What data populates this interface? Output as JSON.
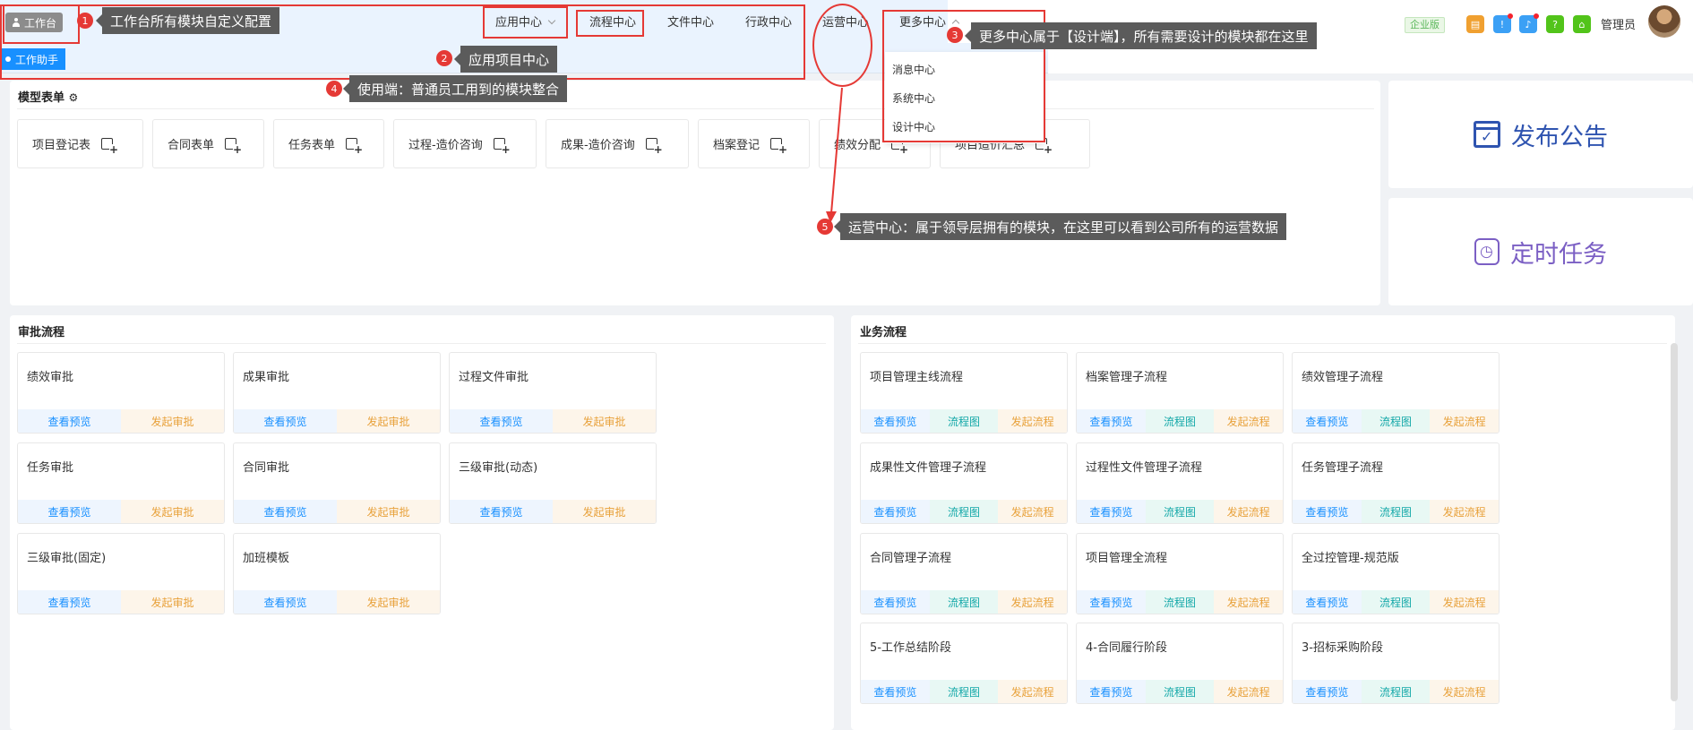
{
  "header": {
    "workbench_tag": "工作台",
    "nav": {
      "app_center": "应用中心",
      "process_center": "流程中心",
      "file_center": "文件中心",
      "admin_center": "行政中心",
      "ops_center": "运营中心",
      "more_center": "更多中心"
    },
    "edition_badge": "企业版",
    "admin_label": "管理员",
    "icon_colors": [
      "#f0a030",
      "#3ba0f5",
      "#3ba0f5",
      "#52c41a",
      "#52c41a"
    ]
  },
  "subbar": {
    "assistant_tab": "工作助手"
  },
  "dropdown": {
    "items": [
      "消息中心",
      "系统中心",
      "设计中心"
    ]
  },
  "model_forms": {
    "title": "模型表单",
    "items": [
      "项目登记表",
      "合同表单",
      "任务表单",
      "过程-造价咨询",
      "成果-造价咨询",
      "档案登记",
      "绩效分配",
      "项目造价汇总"
    ]
  },
  "side_cards": {
    "publish_notice": "发布公告",
    "scheduled_task": "定时任务"
  },
  "approval": {
    "title": "审批流程",
    "preview_label": "查看预览",
    "start_label": "发起审批",
    "items": [
      "绩效审批",
      "成果审批",
      "过程文件审批",
      "任务审批",
      "合同审批",
      "三级审批(动态)",
      "三级审批(固定)",
      "加班模板"
    ]
  },
  "business": {
    "title": "业务流程",
    "preview_label": "查看预览",
    "diagram_label": "流程图",
    "start_label": "发起流程",
    "items": [
      "项目管理主线流程",
      "档案管理子流程",
      "绩效管理子流程",
      "成果性文件管理子流程",
      "过程性文件管理子流程",
      "任务管理子流程",
      "合同管理子流程",
      "项目管理全流程",
      "全过控管理-规范版",
      "5-工作总结阶段",
      "4-合同履行阶段",
      "3-招标采购阶段"
    ]
  },
  "annotations": {
    "n1": "1",
    "t1": "工作台所有模块自定义配置",
    "n2": "2",
    "t2": "应用项目中心",
    "n3": "3",
    "t3": "更多中心属于【设计端】，所有需要设计的模块都在这里",
    "n4": "4",
    "t4": "使用端：普通员工用到的模块整合",
    "n5": "5",
    "t5": "运营中心：属于领导层拥有的模块，在这里可以看到公司所有的运营数据"
  }
}
